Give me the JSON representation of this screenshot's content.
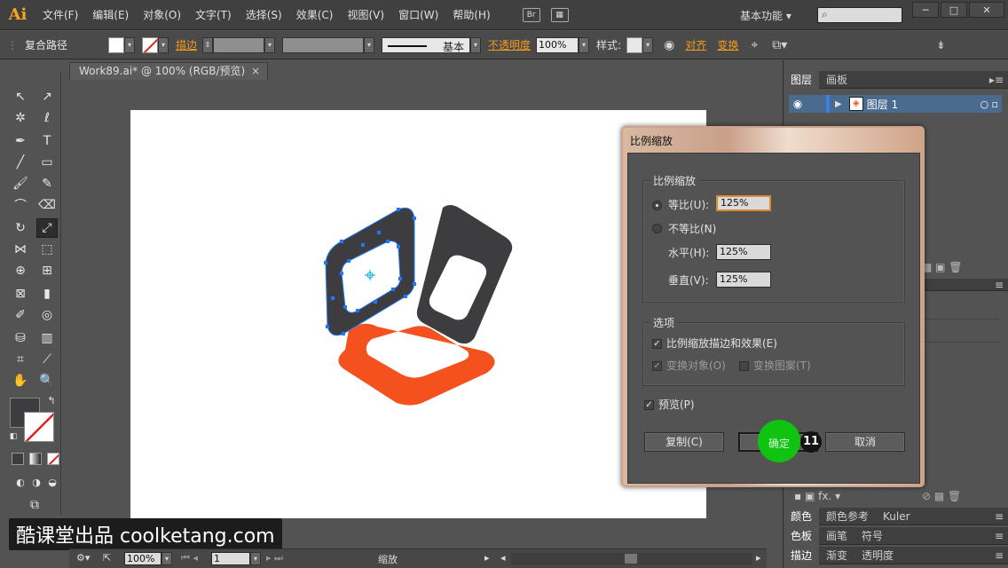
{
  "app": {
    "logo": "Ai",
    "menus": [
      "文件(F)",
      "编辑(E)",
      "对象(O)",
      "文字(T)",
      "选择(S)",
      "效果(C)",
      "视图(V)",
      "窗口(W)",
      "帮助(H)"
    ],
    "bridge_label": "Br",
    "workspace": "基本功能",
    "window_buttons": [
      "─",
      "□",
      "✕"
    ]
  },
  "control_bar": {
    "selection_type": "复合路径",
    "stroke_label": "描边",
    "stroke_style": "基本",
    "opacity_label": "不透明度",
    "opacity_value": "100%",
    "style_label": "样式",
    "align_label": "对齐",
    "transform_label": "变换"
  },
  "document": {
    "tab_title": "Work89.ai* @ 100% (RGB/预览)",
    "close": "×"
  },
  "status_bar": {
    "zoom": "100%",
    "artboard": "1",
    "tool_name": "缩放"
  },
  "panels": {
    "layers_tabs": [
      "图层",
      "画板"
    ],
    "layer_name": "图层 1",
    "color_tabs": [
      "颜色",
      "颜色参考",
      "Kuler"
    ],
    "swatch_tabs": [
      "色板",
      "画笔",
      "符号"
    ],
    "stroke_tabs": [
      "描边",
      "渐变",
      "透明度"
    ],
    "fx_label": "fx."
  },
  "dialog": {
    "title": "比例缩放",
    "scale_group": "比例缩放",
    "uniform_label": "等比(U):",
    "uniform_value": "125%",
    "non_uniform_label": "不等比(N)",
    "horizontal_label": "水平(H):",
    "horizontal_value": "125%",
    "vertical_label": "垂直(V):",
    "vertical_value": "125%",
    "options_group": "选项",
    "scale_strokes_label": "比例缩放描边和效果(E)",
    "transform_objects_label": "变换对象(O)",
    "transform_patterns_label": "变换图案(T)",
    "preview_label": "预览(P)",
    "copy_button": "复制(C)",
    "ok_button": "确定",
    "cancel_button": "取消",
    "step_number": "11"
  },
  "watermark": "酷课堂出品 coolketang.com",
  "colors": {
    "dark_shape": "#3d3d3f",
    "orange_shape": "#f4511e",
    "selection_blue": "#1e78ff",
    "click_green": "#11c311"
  }
}
